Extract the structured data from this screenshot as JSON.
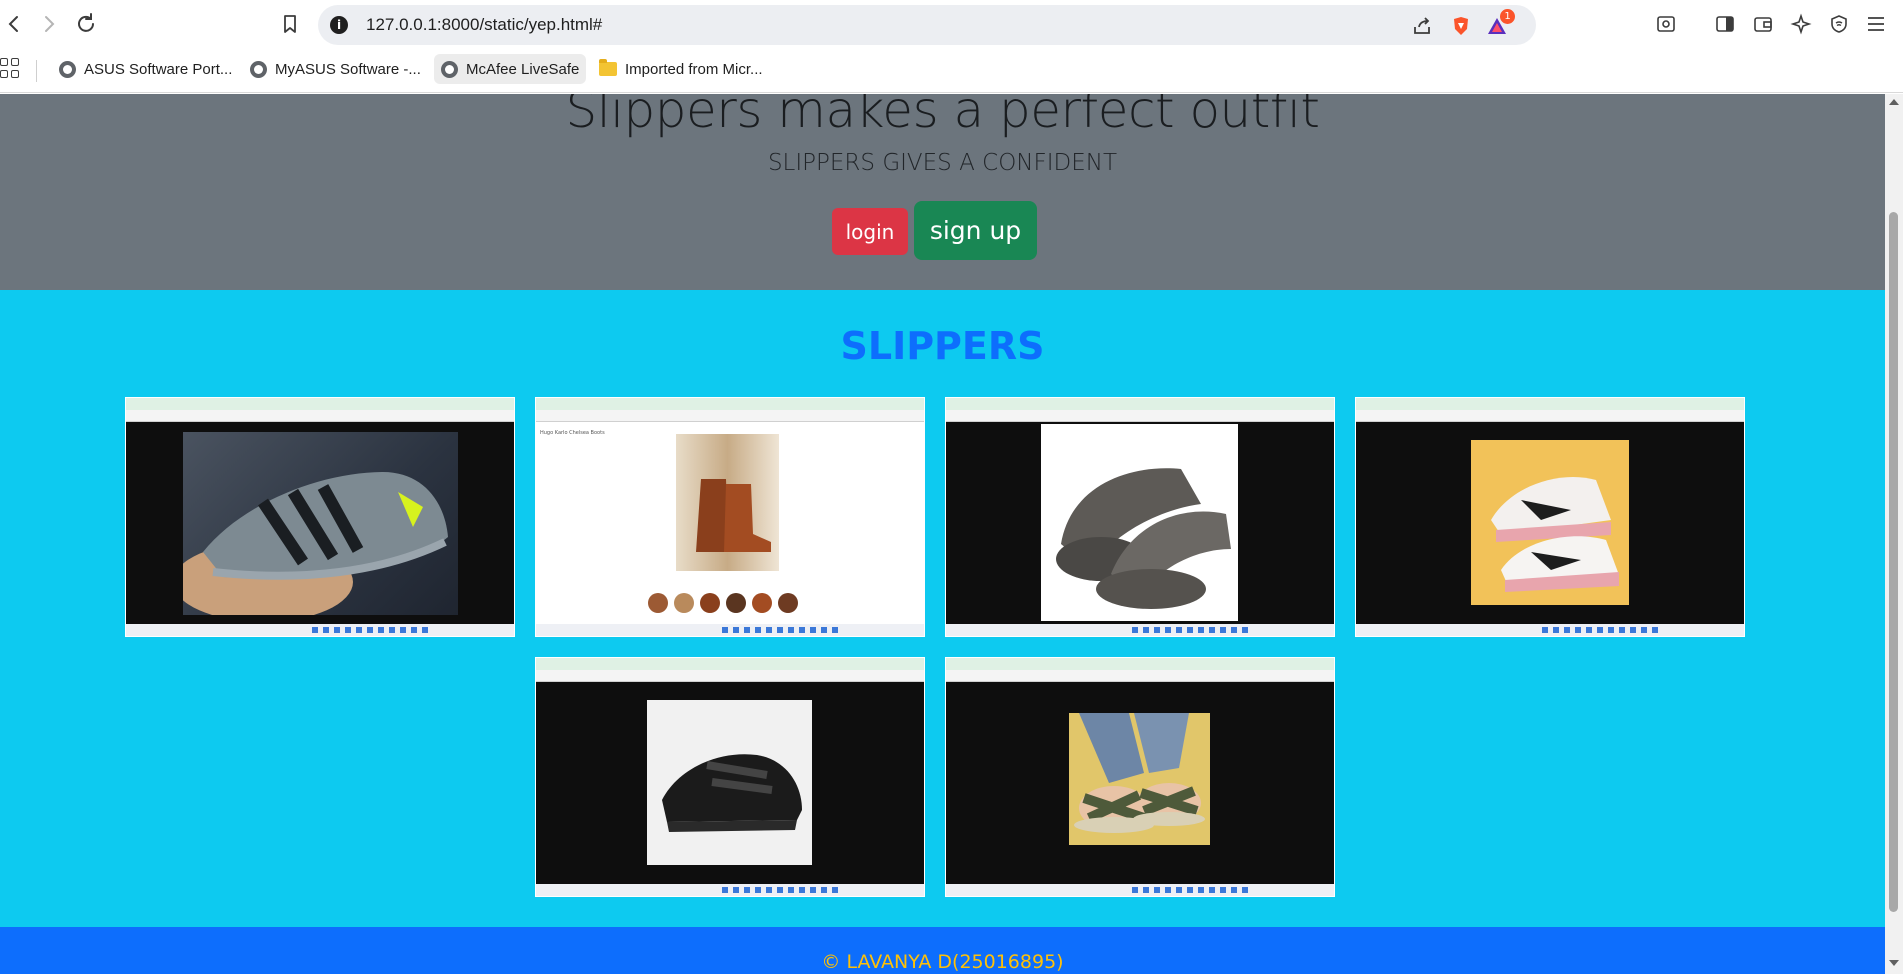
{
  "browser": {
    "url": "127.0.0.1:8000/static/yep.html#",
    "brave_badge": "1",
    "bookmarks": [
      {
        "label": "ASUS Software Port...",
        "icon": "globe-icon"
      },
      {
        "label": "MyASUS Software -...",
        "icon": "globe-icon"
      },
      {
        "label": "McAfee LiveSafe",
        "icon": "globe-icon"
      },
      {
        "label": "Imported from Micr...",
        "icon": "folder-icon"
      }
    ]
  },
  "hero": {
    "title": "Slippers makes a perfect outfit",
    "subtitle": "SLIPPERS GIVES A CONFIDENT",
    "login_label": "login",
    "signup_label": "sign up"
  },
  "gallery": {
    "title": "SLIPPERS",
    "items": [
      {
        "subject": "gray sneaker held in hand"
      },
      {
        "subject": "brown chelsea boots",
        "caption": "Hugo Karlo Chelsea Boots"
      },
      {
        "subject": "gray slide sandals"
      },
      {
        "subject": "white pink black chunky sneakers"
      },
      {
        "subject": "black velcro school shoe"
      },
      {
        "subject": "olive cross strap slippers"
      }
    ]
  },
  "footer": {
    "text": "© LAVANYA D(25016895)"
  },
  "colors": {
    "hero_bg": "#6c757d",
    "section_bg": "#0dcaf0",
    "title": "#0d6efd",
    "login": "#dc3545",
    "signup": "#198754",
    "footer_bg": "#0d6efd",
    "footer_text": "#ffc107"
  }
}
